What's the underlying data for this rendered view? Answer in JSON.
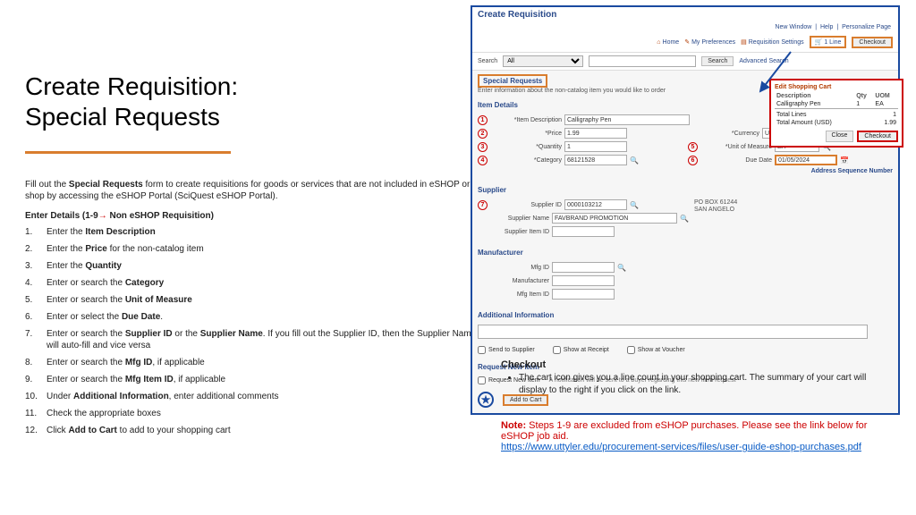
{
  "slide": {
    "title_line1": "Create Requisition:",
    "title_line2": "Special Requests",
    "intro_a": "Fill out the ",
    "intro_b": "Special Requests",
    "intro_c": " form to create requisitions for goods or services that are not included in eSHOP or shop by accessing the eSHOP Portal (SciQuest eSHOP Portal).",
    "enter_details_a": "Enter Details (1-9",
    "enter_details_arrow": "→",
    "enter_details_b": " Non eSHOP Requisition)",
    "steps": [
      {
        "n": "1.",
        "pre": "Enter the ",
        "bold": "Item Description",
        "post": ""
      },
      {
        "n": "2.",
        "pre": "Enter the ",
        "bold": "Price",
        "post": " for the non-catalog item"
      },
      {
        "n": "3.",
        "pre": "Enter the ",
        "bold": "Quantity",
        "post": ""
      },
      {
        "n": "4.",
        "pre": "Enter or search the ",
        "bold": "Category",
        "post": ""
      },
      {
        "n": "5.",
        "pre": "Enter or search the ",
        "bold": "Unit of Measure",
        "post": ""
      },
      {
        "n": "6.",
        "pre": "Enter or select the ",
        "bold": "Due Date",
        "post": "."
      },
      {
        "n": "7.",
        "pre": "Enter or search the ",
        "bold": "Supplier ID",
        "post": " or the ",
        "bold2": "Supplier Name",
        "post2": ". If you fill out the Supplier ID, then the Supplier Name will auto-fill and vice versa"
      },
      {
        "n": "8.",
        "pre": "Enter or search the ",
        "bold": "Mfg ID",
        "post": ", if applicable"
      },
      {
        "n": "9.",
        "pre": "Enter or search the ",
        "bold": "Mfg Item ID",
        "post": ", if applicable"
      },
      {
        "n": "10.",
        "pre": "Under ",
        "bold": "Additional Information",
        "post": ", enter additional comments"
      },
      {
        "n": "11.",
        "pre": "Check the appropriate boxes",
        "bold": "",
        "post": ""
      },
      {
        "n": "12.",
        "pre": "Click ",
        "bold": "Add to Cart",
        "post": " to add to your shopping cart"
      }
    ]
  },
  "checkout": {
    "heading": "Checkout",
    "bullet": "The cart icon gives you a line count in your shopping cart. The summary of your cart will display to the right if you click on the link."
  },
  "note": {
    "label": "Note: ",
    "text": "Steps 1-9 are excluded from eSHOP purchases. Please see the link below for eSHOP job aid.",
    "url": "https://www.uttyler.edu/procurement-services/files/user-guide-eshop-purchases.pdf"
  },
  "app": {
    "window_title": "Create Requisition",
    "toplinks": [
      "New Window",
      "Help",
      "Personalize Page"
    ],
    "nav": {
      "home": "Home",
      "prefs": "My Preferences",
      "settings": "Requisition Settings"
    },
    "cart_link": "1 Line",
    "checkout_btn": "Checkout",
    "search": {
      "label": "Search",
      "scope": "All",
      "search_btn": "Search",
      "advanced": "Advanced Search"
    },
    "special_requests": "Special Requests",
    "sr_sub": "Enter information about the non-catalog item you would like to order",
    "item_details": "Item Details",
    "fields": {
      "item_desc_lbl": "*Item Description",
      "item_desc_val": "Calligraphy Pen",
      "price_lbl": "*Price",
      "price_val": "1.99",
      "qty_lbl": "*Quantity",
      "qty_val": "1",
      "cat_lbl": "*Category",
      "cat_val": "68121528",
      "currency_lbl": "*Currency",
      "currency_val": "USD",
      "uom_lbl": "*Unit of Measure",
      "uom_val": "EA",
      "due_lbl": "Due Date",
      "due_val": "01/05/2024"
    },
    "addr_seq": "Address Sequence Number",
    "supplier": {
      "heading": "Supplier",
      "id_lbl": "Supplier ID",
      "id_val": "0000103212",
      "name_lbl": "Supplier Name",
      "name_val": "FAVBRAND PROMOTION",
      "item_lbl": "Supplier Item ID",
      "addr1": "PO BOX 61244",
      "addr2": "SAN ANGELO"
    },
    "mfg": {
      "heading": "Manufacturer",
      "id_lbl": "Mfg ID",
      "name_lbl": "Manufacturer",
      "item_lbl": "Mfg Item ID"
    },
    "additional": "Additional Information",
    "send_supplier": "Send to Supplier",
    "show_receipt": "Show at Receipt",
    "show_voucher": "Show at Voucher",
    "request_new": "Request New Item",
    "request_chk": "Request New Item",
    "notif": "A notification will be sent to a buyer regarding this new item request",
    "add_to_cart": "Add to Cart"
  },
  "cart": {
    "heading": "Edit Shopping Cart",
    "cols": [
      "Description",
      "Qty",
      "UOM"
    ],
    "row": [
      "Calligraphy Pen",
      "1",
      "EA"
    ],
    "total_lines_lbl": "Total Lines",
    "total_lines": "1",
    "total_amt_lbl": "Total Amount (USD)",
    "total_amt": "1.99",
    "close": "Close",
    "checkout": "Checkout"
  }
}
